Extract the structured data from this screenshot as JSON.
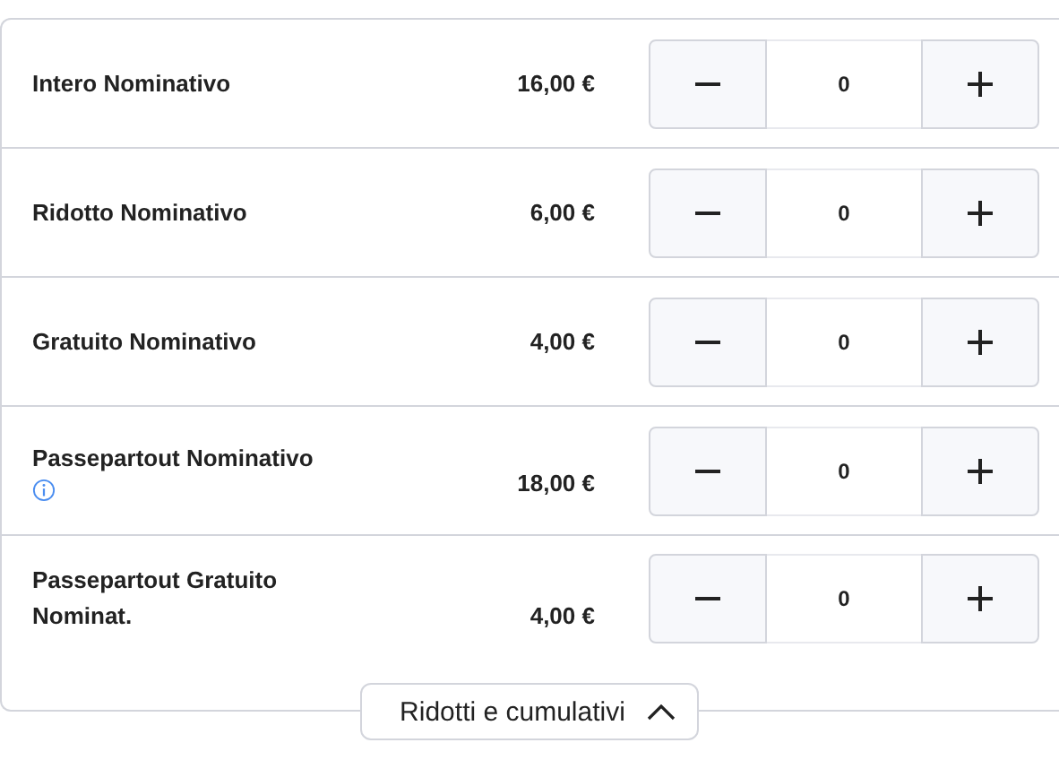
{
  "tickets": [
    {
      "name": "Intero Nominativo",
      "info": false,
      "price": "16,00 €",
      "quantity": "0"
    },
    {
      "name": "Ridotto Nominativo",
      "info": false,
      "price": "6,00 €",
      "quantity": "0"
    },
    {
      "name": "Gratuito Nominativo",
      "info": false,
      "price": "4,00 €",
      "quantity": "0"
    },
    {
      "name": "Passepartout Nominativo",
      "info": true,
      "price": "18,00 €",
      "quantity": "0"
    },
    {
      "name": "Passepartout Gratuito Nominat.",
      "info": false,
      "price": "4,00 €",
      "quantity": "0"
    }
  ],
  "toggle": {
    "label": "Ridotti e cumulativi",
    "expanded": true
  }
}
